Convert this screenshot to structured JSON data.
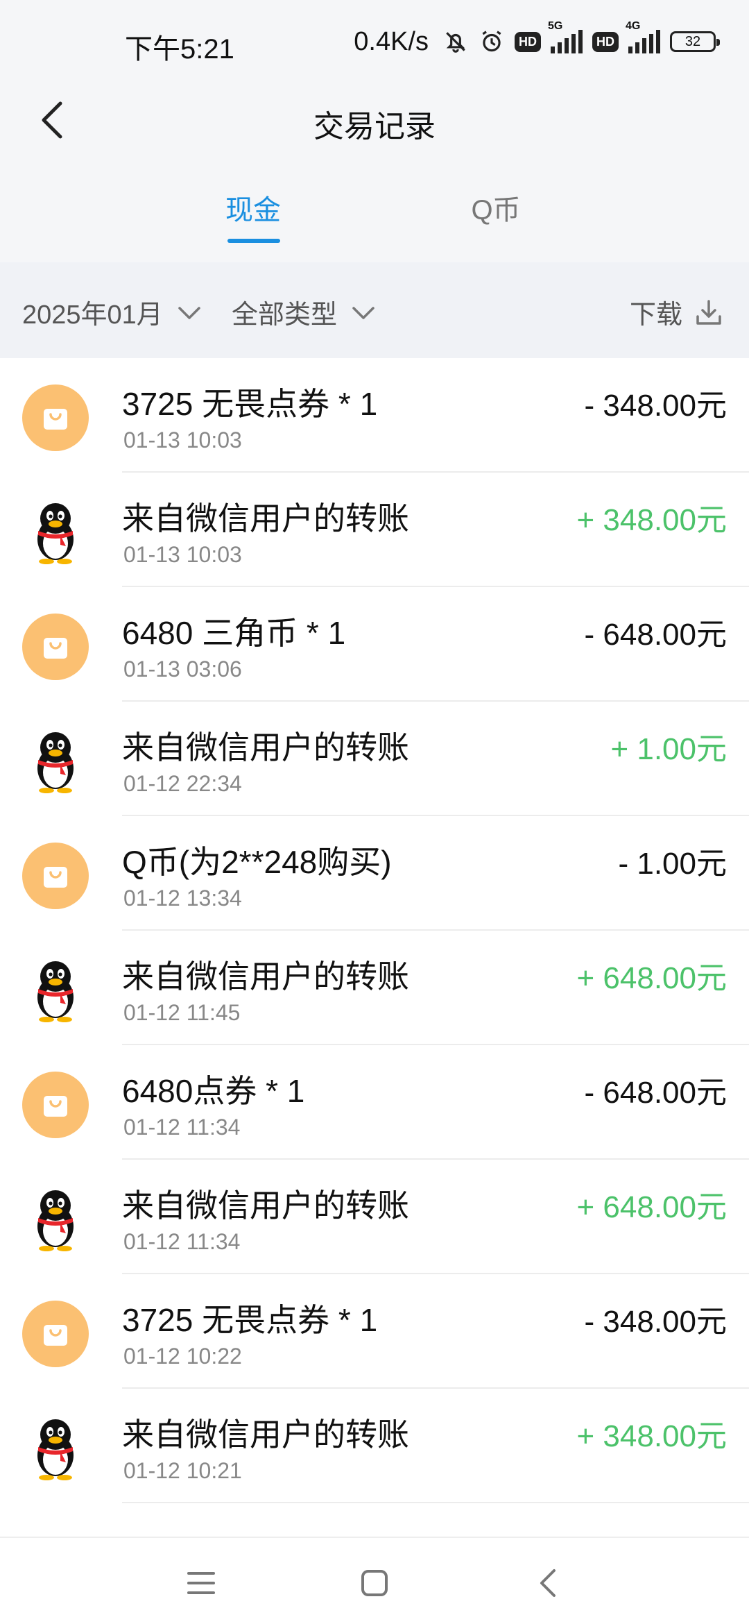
{
  "status_bar": {
    "time": "下午5:21",
    "net_speed": "0.4K/s",
    "hd_label": "HD",
    "sim1_label": "5G",
    "sim2_label": "4G",
    "battery": "32"
  },
  "header": {
    "title": "交易记录"
  },
  "tabs": [
    {
      "label": "现金",
      "active": true
    },
    {
      "label": "Q币",
      "active": false
    }
  ],
  "filters": {
    "month": "2025年01月",
    "type": "全部类型",
    "download": "下载"
  },
  "transactions": [
    {
      "title": "3725 无畏点券 * 1",
      "time": "01-13 10:03",
      "amount": "- 348.00元",
      "avatar_icon": "shopping-bag-icon"
    },
    {
      "title": "来自微信用户的转账",
      "time": "01-13 10:03",
      "amount": "+ 348.00元",
      "avatar_icon": "qq-penguin-icon"
    },
    {
      "title": "6480 三角币 * 1",
      "time": "01-13 03:06",
      "amount": "- 648.00元",
      "avatar_icon": "shopping-bag-icon"
    },
    {
      "title": "来自微信用户的转账",
      "time": "01-12 22:34",
      "amount": "+ 1.00元",
      "avatar_icon": "qq-penguin-icon"
    },
    {
      "title": "Q币(为2**248购买)",
      "time": "01-12 13:34",
      "amount": "- 1.00元",
      "avatar_icon": "shopping-bag-icon"
    },
    {
      "title": "来自微信用户的转账",
      "time": "01-12 11:45",
      "amount": "+ 648.00元",
      "avatar_icon": "qq-penguin-icon"
    },
    {
      "title": "6480点券 * 1",
      "time": "01-12 11:34",
      "amount": "- 648.00元",
      "avatar_icon": "shopping-bag-icon"
    },
    {
      "title": "来自微信用户的转账",
      "time": "01-12 11:34",
      "amount": "+ 648.00元",
      "avatar_icon": "qq-penguin-icon"
    },
    {
      "title": "3725 无畏点券 * 1",
      "time": "01-12 10:22",
      "amount": "- 348.00元",
      "avatar_icon": "shopping-bag-icon"
    },
    {
      "title": "来自微信用户的转账",
      "time": "01-12 10:21",
      "amount": "+ 348.00元",
      "avatar_icon": "qq-penguin-icon"
    }
  ],
  "colors": {
    "accent": "#1a8fe0",
    "positive": "#4cc26a",
    "shop_avatar": "#fbc072"
  }
}
